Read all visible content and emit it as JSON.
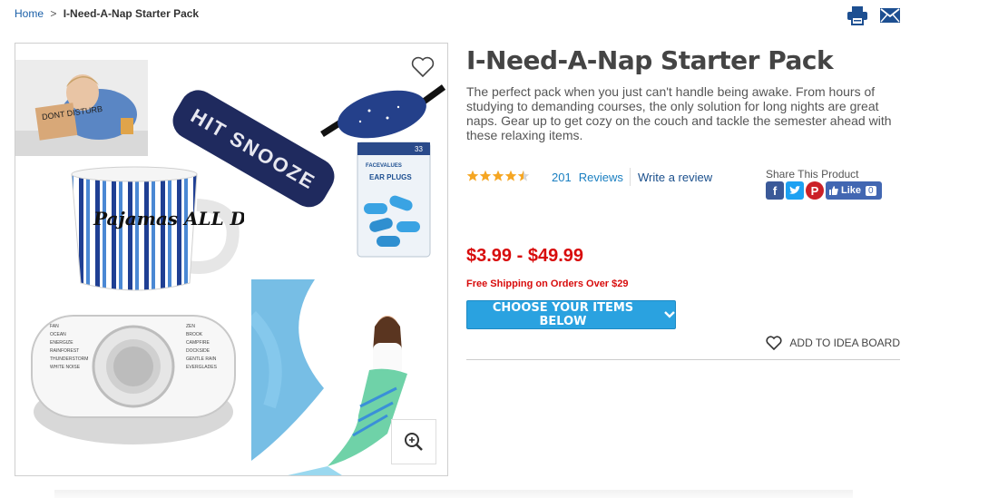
{
  "breadcrumb": {
    "home": "Home",
    "separator": ">",
    "current": "I-Need-A-Nap Starter Pack"
  },
  "header_icons": {
    "print": "print-icon",
    "email": "email-icon"
  },
  "gallery": {
    "items": [
      "sleeping-man-photo",
      "hit-snooze-pillow",
      "sleep-mask",
      "ear-plugs-pack",
      "pajamas-mug",
      "sound-machine",
      "mermaid-blanket-photo"
    ],
    "mug_text": "Pajamas ALL DAY",
    "pillow_text": "HIT SNOOZE",
    "sign_text": "DONT DISTURB",
    "earplug_brand": "FACEVALUES",
    "earplug_label": "EAR PLUGS",
    "earplug_count": "33",
    "sound_left": [
      "FAN",
      "OCEAN",
      "ENERGIZE",
      "RAINFOREST",
      "THUNDERSTORM",
      "WHITE NOISE"
    ],
    "sound_right": [
      "ZEN",
      "BROOK",
      "CAMPFIRE",
      "DOCKSIDE",
      "GENTLE RAIN",
      "EVERGLADES"
    ]
  },
  "product": {
    "title": "I-Need-A-Nap Starter Pack",
    "description": "The perfect pack when you just can't handle being awake. From hours of studying to demanding courses, the only solution for long nights are great naps. Gear up to get cozy on the couch and tackle the semester ahead with these relaxing items.",
    "rating": 4.5,
    "reviews_count": "201",
    "reviews_label": "Reviews",
    "write_review": "Write a review",
    "share_label": "Share This Product",
    "like_label": "Like",
    "like_count": "0",
    "price": "$3.99 - $49.99",
    "shipping": "Free Shipping on Orders Over $29",
    "choose_button": "CHOOSE YOUR ITEMS BELOW",
    "idea_board": "ADD TO IDEA BOARD"
  },
  "colors": {
    "link": "#1a7fc1",
    "price": "#d80c0c",
    "button": "#2aa2e0",
    "star": "#f5a623",
    "facebook": "#3b5998",
    "twitter": "#1da1f2",
    "pinterest": "#cb2027"
  }
}
